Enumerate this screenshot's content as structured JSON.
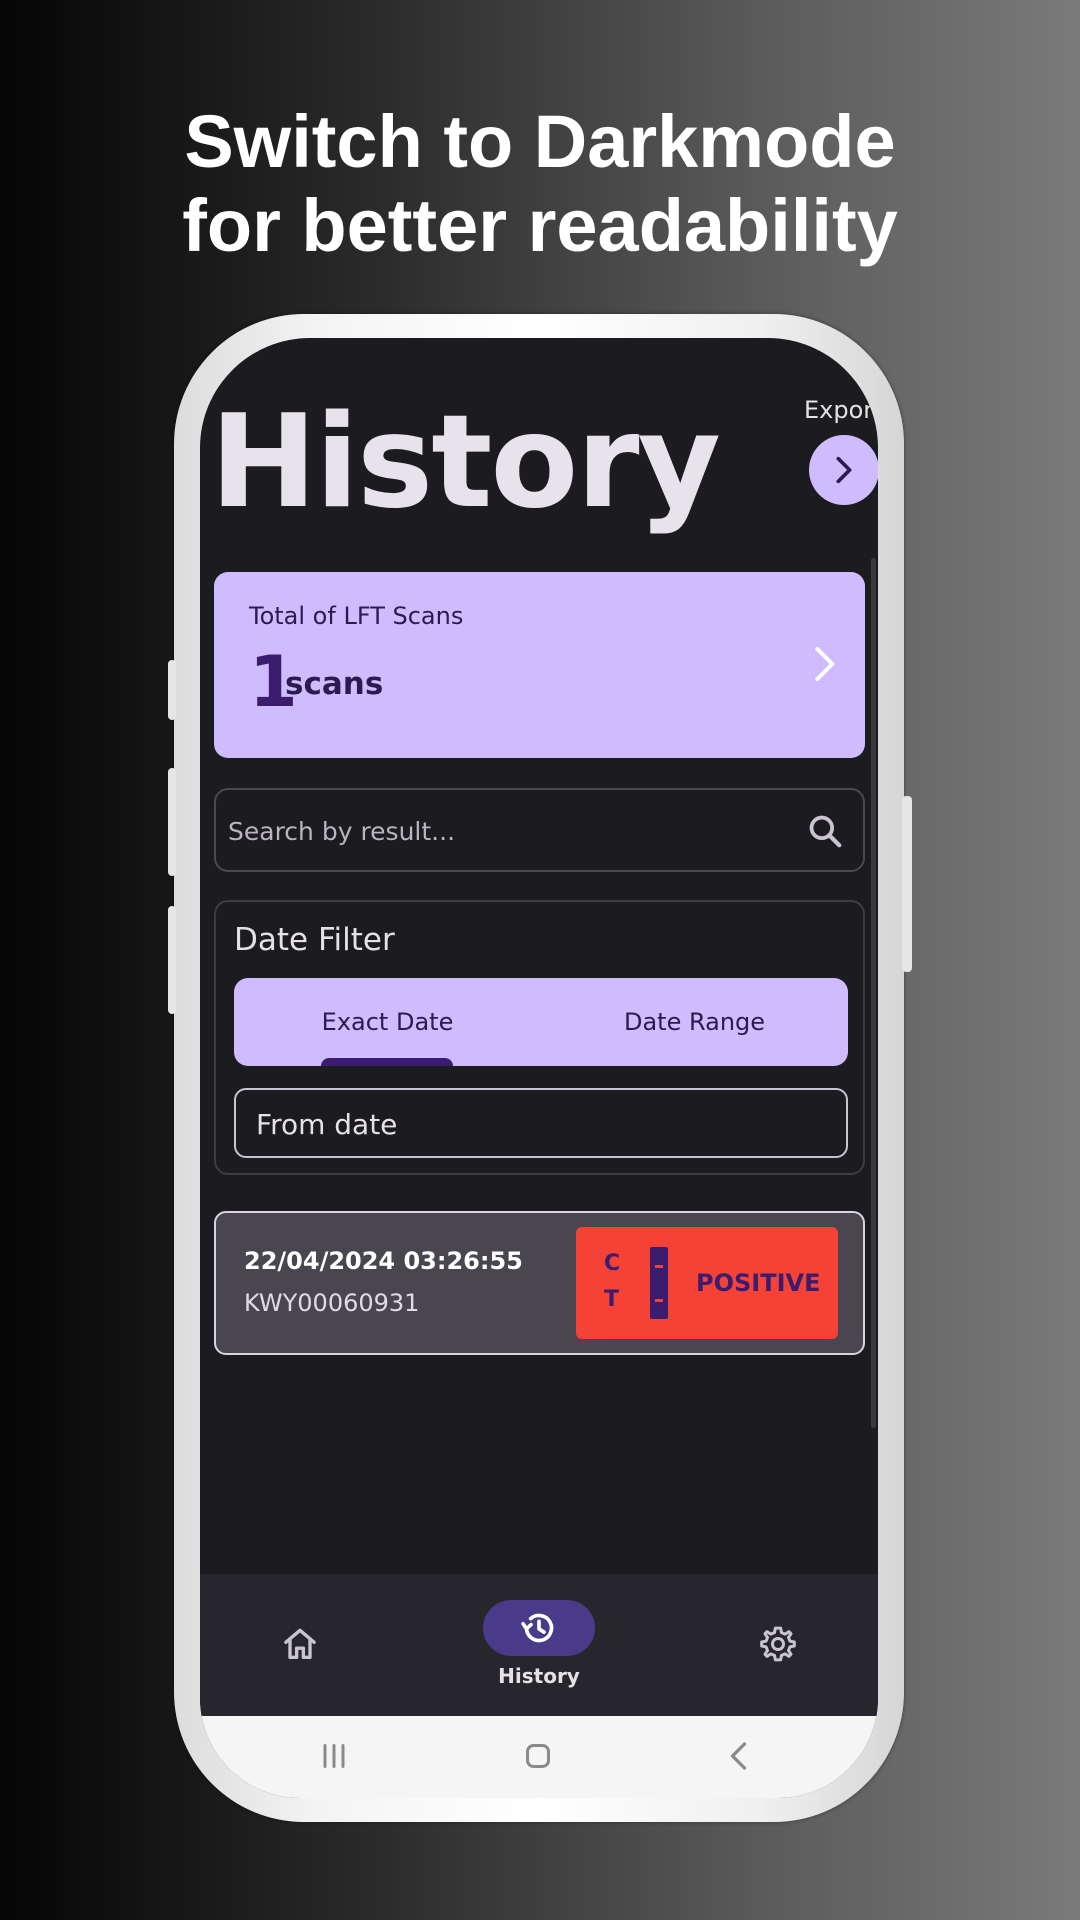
{
  "promo": {
    "headline_line1": "Switch to Darkmode",
    "headline_line2": "for better readability"
  },
  "colors": {
    "accent": "#cfbcff",
    "accent_dark": "#3b1c6e",
    "background": "#1c1b1f",
    "positive": "#f44336"
  },
  "header": {
    "title": "History",
    "export_label": "Export",
    "export_icon": "chevron-right-icon"
  },
  "summary": {
    "label": "Total of LFT Scans",
    "count": "1",
    "unit": "scans",
    "icon": "chevron-right-icon"
  },
  "search": {
    "placeholder": "Search by result...",
    "value": "",
    "icon": "search-icon"
  },
  "date_filter": {
    "heading": "Date Filter",
    "tabs": [
      {
        "label": "Exact Date",
        "selected": true
      },
      {
        "label": "Date Range",
        "selected": false
      }
    ],
    "from_date_placeholder": "From date"
  },
  "results": [
    {
      "datetime": "22/04/2024 03:26:55",
      "code": "KWY00060931",
      "control_label": "C",
      "test_label": "T",
      "result": "POSITIVE"
    }
  ],
  "bottom_nav": {
    "items": [
      {
        "icon": "home-icon",
        "label": "",
        "active": false
      },
      {
        "icon": "history-icon",
        "label": "History",
        "active": true
      },
      {
        "icon": "gear-icon",
        "label": "",
        "active": false
      }
    ]
  },
  "system_nav": {
    "items": [
      "recent-apps-icon",
      "home-button-icon",
      "back-icon"
    ]
  }
}
